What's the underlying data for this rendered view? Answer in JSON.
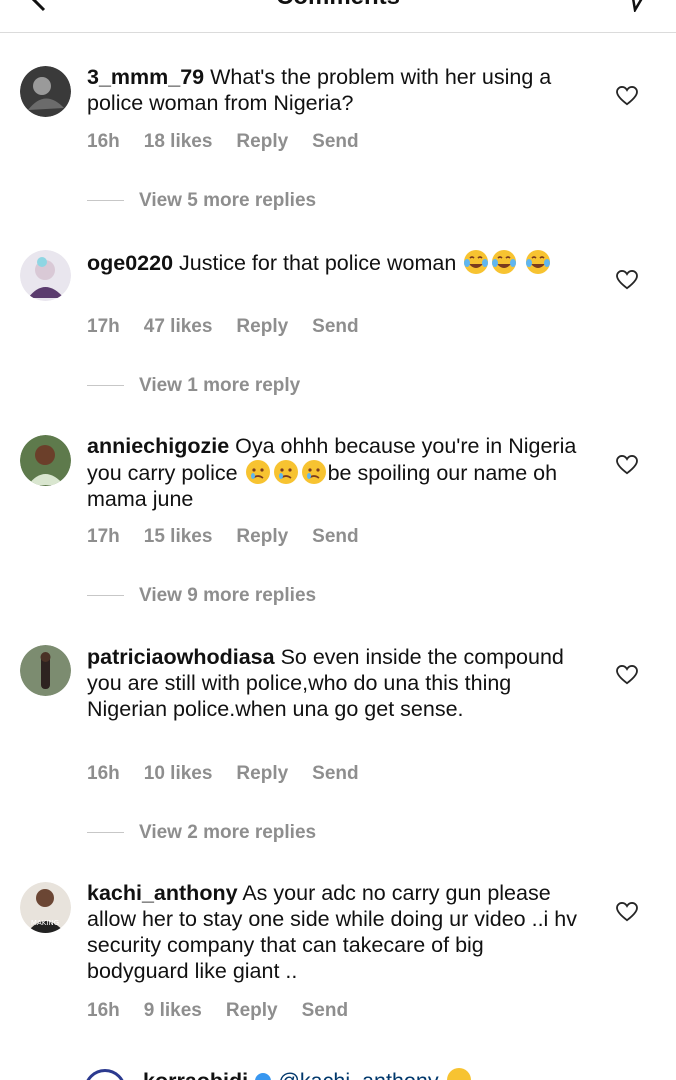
{
  "header": {
    "title": "Comments"
  },
  "comments": [
    {
      "username": "3_mmm_79",
      "text": "What's the problem with her using a police woman from Nigeria?",
      "time": "16h",
      "likes": "18 likes",
      "reply": "Reply",
      "send": "Send",
      "view_replies": "View 5 more replies"
    },
    {
      "username": "oge0220",
      "text": "Justice for that police woman",
      "time": "17h",
      "likes": "47 likes",
      "reply": "Reply",
      "send": "Send",
      "view_replies": "View 1 more reply"
    },
    {
      "username": "anniechigozie",
      "text_a": "Oya ohhh because you're in Nigeria you carry police",
      "text_b": "be spoiling our name oh mama june",
      "time": "17h",
      "likes": "15 likes",
      "reply": "Reply",
      "send": "Send",
      "view_replies": "View 9 more replies"
    },
    {
      "username": "patriciaowhodiasa",
      "text": "So even inside the compound you are still with police,who do una this thing Nigerian police.when una go get sense.",
      "time": "16h",
      "likes": "10 likes",
      "reply": "Reply",
      "send": "Send",
      "view_replies": "View 2 more replies"
    },
    {
      "username": "kachi_anthony",
      "text": "As your adc no carry gun please allow her to stay one side while doing ur video ..i hv security company that can takecare of big bodyguard like giant ..",
      "time": "16h",
      "likes": "9 likes",
      "reply": "Reply",
      "send": "Send"
    }
  ],
  "partial_reply": {
    "username": "korraobidi",
    "mention": "@kachi_anthony"
  },
  "icons": {
    "back": "back-chevron-icon",
    "heart": "heart-outline-icon",
    "send": "paper-plane-icon",
    "emoji_laugh": "tears-of-joy-emoji",
    "emoji_cry": "crying-face-emoji",
    "verified": "verified-badge-icon"
  },
  "colors": {
    "muted": "#8e8e8e",
    "text": "#111111",
    "divider": "#dbdbdb"
  }
}
